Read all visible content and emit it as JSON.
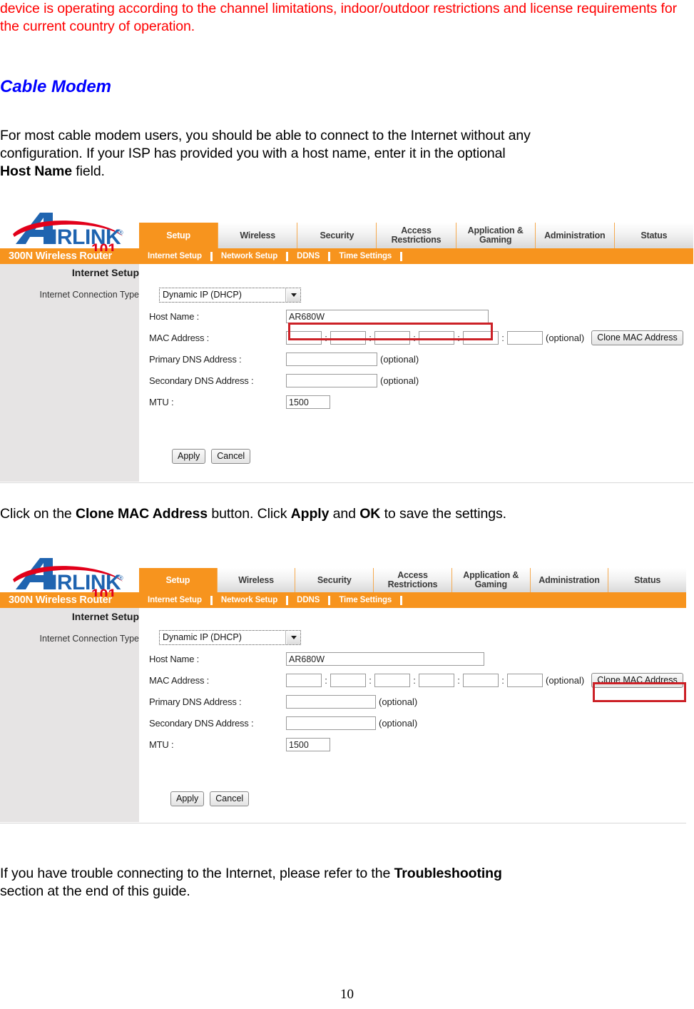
{
  "document": {
    "warning_paragraph": "device is operating according to the channel limitations, indoor/outdoor restrictions and license requirements for the current country of operation.",
    "section_heading": "Cable Modem",
    "intro_line1": "For most cable modem users, you should be able to connect to the Internet without any",
    "intro_line2": "configuration. If your ISP has provided you with a host name, enter it in the optional",
    "intro_bold": "Host Name",
    "intro_tail": " field.",
    "mid_caption": {
      "part1": "Click on the ",
      "bold1": "Clone MAC Address",
      "part2": " button. Click ",
      "bold2": "Apply",
      "part3": " and ",
      "bold3": "OK",
      "part4": " to save the settings."
    },
    "closing": {
      "part1": "If you have trouble connecting to the Internet, please refer to the ",
      "bold1": "Troubleshooting",
      "part2": "section at the end of this guide."
    },
    "page_number": "10"
  },
  "router_ui": {
    "logo": {
      "brand_main": "AIRLINK",
      "brand_suffix": "101",
      "registered_mark": "®"
    },
    "model_name": "300N Wireless Router",
    "tabs": [
      {
        "label": "Setup",
        "active": true
      },
      {
        "label": "Wireless",
        "active": false
      },
      {
        "label": "Security",
        "active": false
      },
      {
        "label": "Access Restrictions",
        "active": false
      },
      {
        "label": "Application & Gaming",
        "active": false
      },
      {
        "label": "Administration",
        "active": false
      },
      {
        "label": "Status",
        "active": false
      }
    ],
    "subnav": [
      "Internet Setup",
      "Network Setup",
      "DDNS",
      "Time Settings"
    ],
    "side_panel": {
      "title": "Internet Setup",
      "subtitle": "Internet Connection Type"
    },
    "fields": {
      "connection_type_label": "",
      "connection_type_value": "Dynamic IP (DHCP)",
      "host_name_label": "Host Name :",
      "host_name_value": "AR680W",
      "mac_address_label": "MAC Address :",
      "mac_octets": [
        "",
        "",
        "",
        "",
        "",
        ""
      ],
      "mac_optional_note": "(optional)",
      "primary_dns_label": "Primary DNS Address :",
      "primary_dns_value": "",
      "primary_dns_note": "(optional)",
      "secondary_dns_label": "Secondary DNS Address :",
      "secondary_dns_value": "",
      "secondary_dns_note": "(optional)",
      "mtu_label": "MTU :",
      "mtu_value": "1500"
    },
    "buttons": {
      "clone_mac": "Clone MAC Address",
      "apply": "Apply",
      "cancel": "Cancel"
    },
    "colors": {
      "accent_orange": "#f7941e",
      "highlight_red": "#cc2127",
      "logo_blue": "#1f64b0",
      "logo_red": "#e2001a",
      "side_gray": "#e6e4e4"
    }
  },
  "highlights": {
    "figure1_target": "host-name-field",
    "figure2_target": "clone-mac-button"
  }
}
